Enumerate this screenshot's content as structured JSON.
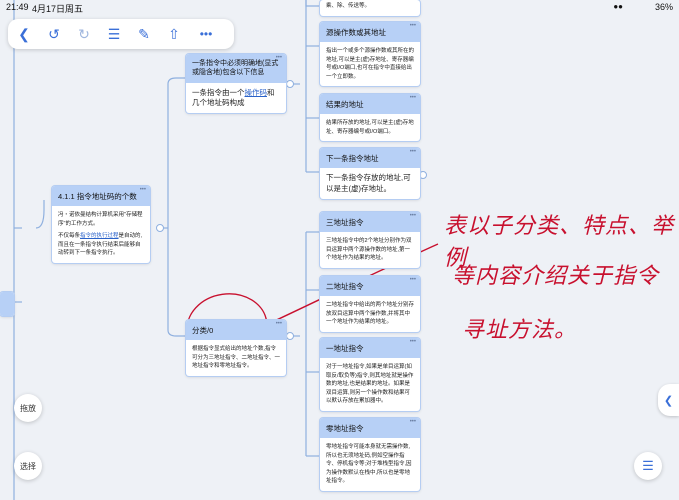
{
  "status_bar": {
    "time": "21:49",
    "date": "4月17日周五",
    "battery": "36%"
  },
  "toolbar": {
    "icons": [
      "back-icon",
      "undo-icon",
      "redo-icon",
      "list-icon",
      "edit-icon",
      "share-icon",
      "more-icon"
    ]
  },
  "root_card": {
    "title": "4.1.1 指令地址码的个数",
    "body1": "冯・诺依曼结构计算机采用\"存储程序\"的工作方式。",
    "body2_pre": "不仅每条",
    "body2_link": "指令的执行过程",
    "body2_post": "是自动的,而且在一条指令执行结束后能够自动转到下一条指令执行。"
  },
  "info_card": {
    "title": "一条指令中必须明确地(显式或隐含地)包含以下信息",
    "body_pre": "一条指令由一个",
    "body_link": "操作码",
    "body_post": "和几个地址码构成"
  },
  "class_card": {
    "title": "分类/0",
    "body": "根据指令显式给出的地址个数,指令可分为三地址指令、二地址指令、一地址指令和零地址指令。",
    "links": [
      "三地址指令",
      "二地址指令",
      "一地址指令",
      "零地址指令"
    ]
  },
  "top_fragment": {
    "text": "乘、除、传送等。"
  },
  "operand_card": {
    "title": "源操作数或其地址",
    "body": "指出一个或多个源操作数或其所在的地址,可以是主(虚)存地址、寄存器编号或I/O端口,也可在指令中直接给出一个立即数。"
  },
  "result_card": {
    "title": "结果的地址",
    "body": "结果所存放的地址,可以是主(虚)存地址、寄存器编号或I/O端口。"
  },
  "next_card": {
    "title": "下一条指令地址",
    "body": "下一条指令存放的地址,可以是主(虚)存地址。"
  },
  "three_card": {
    "title": "三地址指令",
    "body": "三地址指令中的2个地址分别作为双目运算中两个源操作数的地址,第一个地址作为结果的地址。"
  },
  "two_card": {
    "title": "二地址指令",
    "body": "二地址指令中给出的两个地址分别存放双目运算中两个操作数,并将其中一个地址作为结果的地址。"
  },
  "one_card": {
    "title": "一地址指令",
    "body": "对于一地址指令,如果是单目运算(如取反/取负等)指令,则其地址就是操作数的地址,也是结果的地址。如果是双目运算,则另一个操作数和结果可以默认存放在累加器中。"
  },
  "zero_card": {
    "title": "零地址指令",
    "body": "零地址指令可能本身就无需操作数,所以也无须地址码,例如空操作指令、停机指令等;对于堆栈型指令,因为操作数默认在栈中,所以也是零地址指令。"
  },
  "handwriting": {
    "line1": "表以子分类、特点、举例",
    "line2": "等内容介绍关于指令",
    "line3": "寻址方法。"
  },
  "side_buttons": {
    "drag": "拖放",
    "select": "选择"
  },
  "accent_color": "#3a6fd8",
  "header_color": "#b7d0f6",
  "annotation_color": "#c8102e"
}
